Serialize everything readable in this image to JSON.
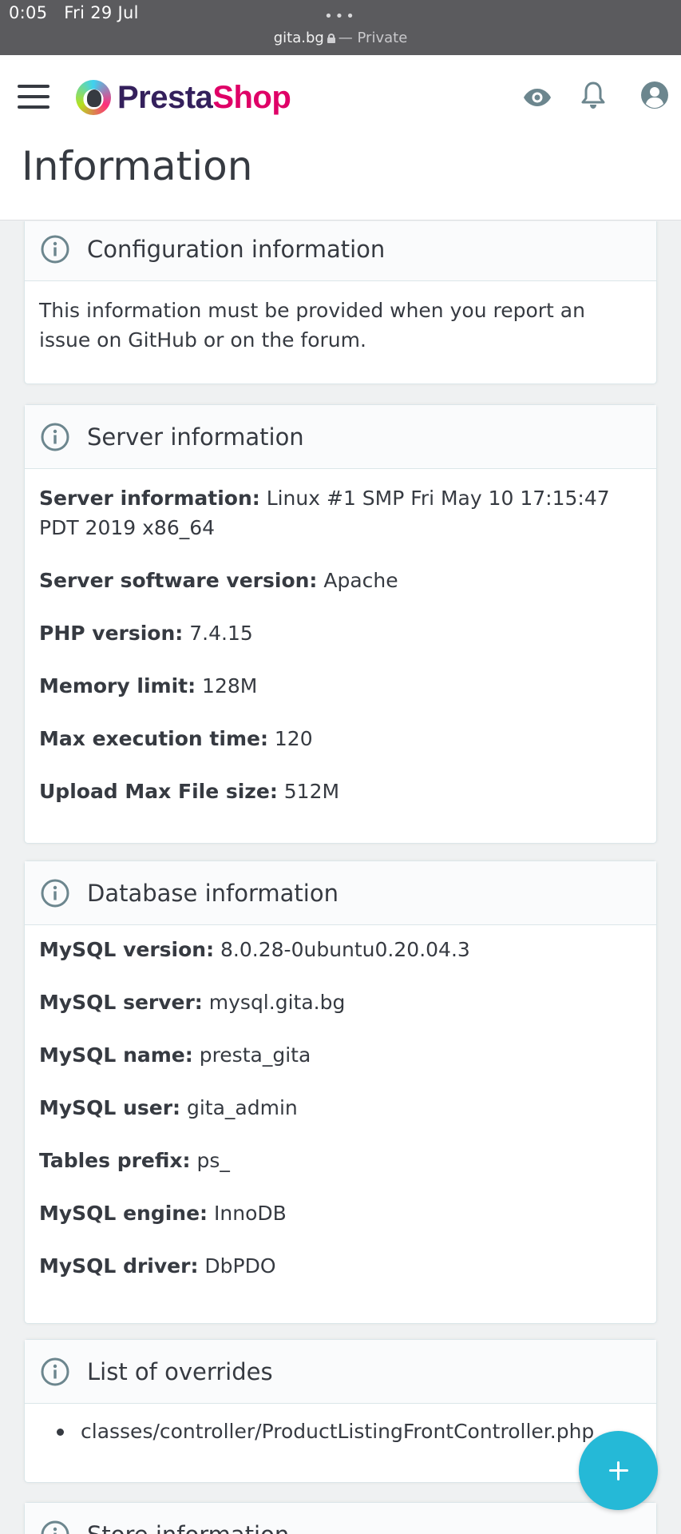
{
  "statusbar": {
    "time": "0:05",
    "date": "Fri 29 Jul",
    "dots": "•••",
    "domain": "gita.bg",
    "private": "— Private"
  },
  "header": {
    "logo_part1": "Presta",
    "logo_part2": "Shop",
    "page_title": "Information",
    "icons": [
      "menu-icon",
      "eye-icon",
      "bell-icon",
      "user-icon"
    ]
  },
  "cards": {
    "config": {
      "title": "Configuration information",
      "text": "This information must be provided when you report an issue on GitHub or on the forum."
    },
    "server": {
      "title": "Server information",
      "rows": [
        {
          "label": "Server information:",
          "value": "Linux #1 SMP Fri May 10 17:15:47 PDT 2019 x86_64"
        },
        {
          "label": "Server software version:",
          "value": "Apache"
        },
        {
          "label": "PHP version:",
          "value": "7.4.15"
        },
        {
          "label": "Memory limit:",
          "value": "128M"
        },
        {
          "label": "Max execution time:",
          "value": "120"
        },
        {
          "label": "Upload Max File size:",
          "value": "512M"
        }
      ]
    },
    "database": {
      "title": "Database information",
      "rows": [
        {
          "label": "MySQL version:",
          "value": "8.0.28-0ubuntu0.20.04.3"
        },
        {
          "label": "MySQL server:",
          "value": "mysql.gita.bg"
        },
        {
          "label": "MySQL name:",
          "value": "presta_gita"
        },
        {
          "label": "MySQL user:",
          "value": "gita_admin"
        },
        {
          "label": "Tables prefix:",
          "value": "ps_"
        },
        {
          "label": "MySQL engine:",
          "value": "InnoDB"
        },
        {
          "label": "MySQL driver:",
          "value": "DbPDO"
        }
      ]
    },
    "overrides": {
      "title": "List of overrides",
      "items": [
        "classes/controller/ProductListingFrontController.php"
      ]
    },
    "store": {
      "title": "Store information"
    }
  },
  "colors": {
    "accent": "#25b9d7",
    "brand_dark": "#34205c",
    "brand_pink": "#df0067",
    "text": "#363a41"
  }
}
